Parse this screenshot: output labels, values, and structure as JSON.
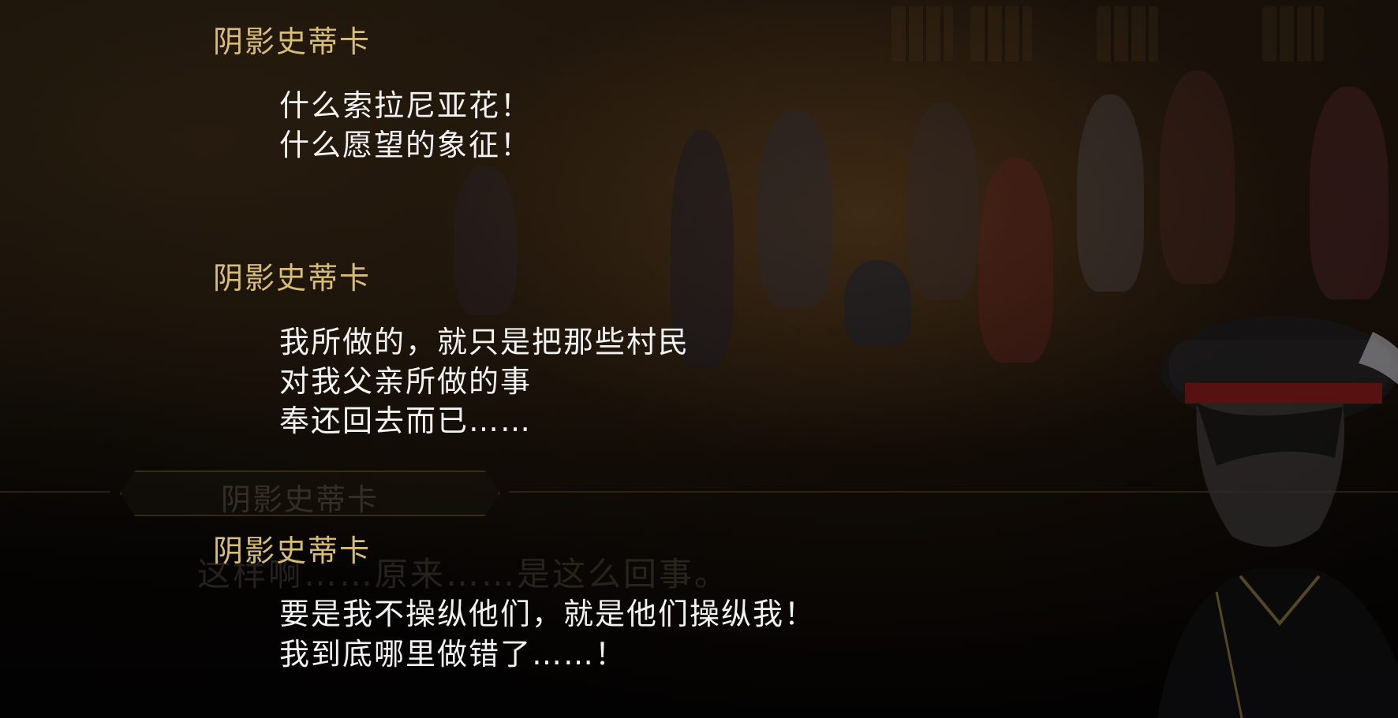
{
  "backlog": [
    {
      "speaker": "阴影史蒂卡",
      "lines": [
        "什么索拉尼亚花！",
        "什么愿望的象征！"
      ]
    },
    {
      "speaker": "阴影史蒂卡",
      "lines": [
        "我所做的，就只是把那些村民",
        "对我父亲所做的事",
        "奉还回去而已……"
      ]
    },
    {
      "speaker": "阴影史蒂卡",
      "lines": [
        "要是我不操纵他们，就是他们操纵我！",
        "我到底哪里做错了……！"
      ]
    }
  ],
  "background_dialog": {
    "speaker": "阴影史蒂卡",
    "line": "这样啊……原来……是这么回事。"
  },
  "colors": {
    "speaker": "#d8bd74",
    "text": "#f2f2f2"
  }
}
